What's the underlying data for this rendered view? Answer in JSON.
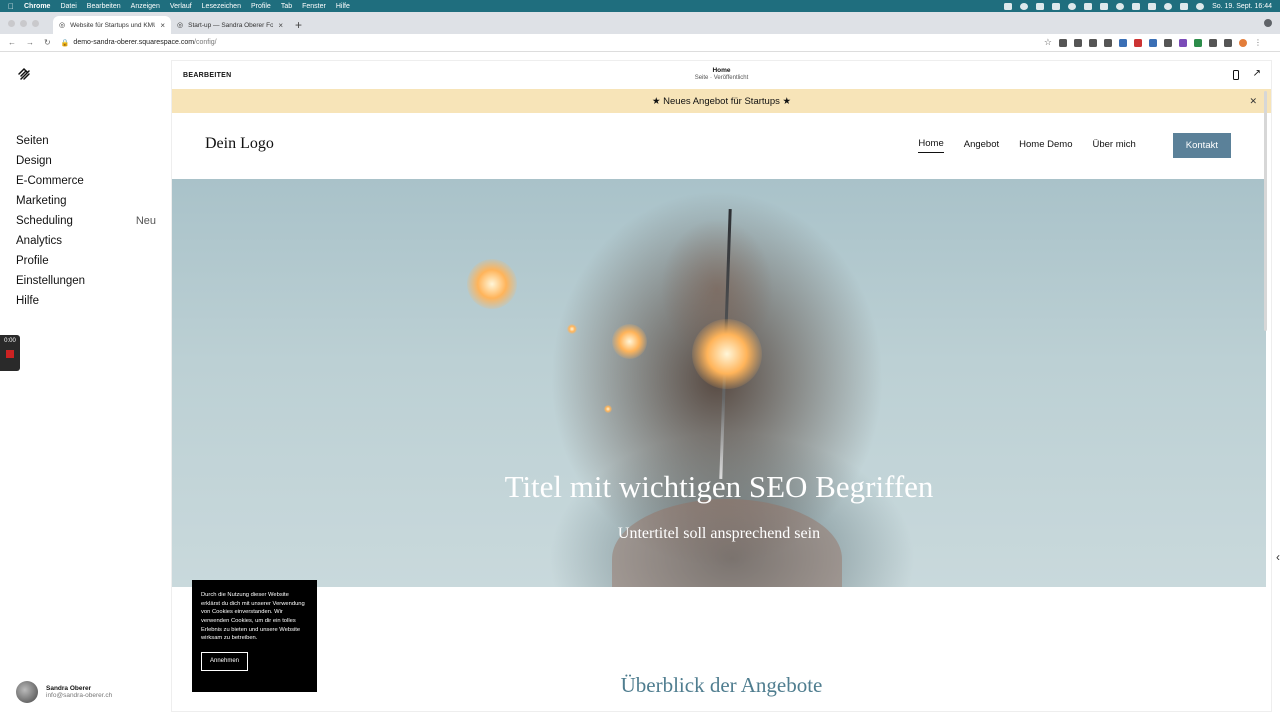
{
  "menubar": {
    "app": "Chrome",
    "items": [
      "Datei",
      "Bearbeiten",
      "Anzeigen",
      "Verlauf",
      "Lesezeichen",
      "Profile",
      "Tab",
      "Fenster",
      "Hilfe"
    ],
    "datetime": "So. 19. Sept. 16:44"
  },
  "tabs": [
    {
      "title": "Website für Startups und KMU",
      "icon": "squarespace-icon",
      "active": true
    },
    {
      "title": "Start-up — Sandra Oberer Fotografie",
      "icon": "squarespace-icon",
      "active": false
    }
  ],
  "address": {
    "host": "demo-sandra-oberer.squarespace.com",
    "path": "/config/"
  },
  "sidebar": {
    "items": [
      {
        "label": "Seiten",
        "badge": ""
      },
      {
        "label": "Design",
        "badge": ""
      },
      {
        "label": "E-Commerce",
        "badge": ""
      },
      {
        "label": "Marketing",
        "badge": ""
      },
      {
        "label": "Scheduling",
        "badge": "Neu"
      },
      {
        "label": "Analytics",
        "badge": ""
      },
      {
        "label": "Profile",
        "badge": ""
      },
      {
        "label": "Einstellungen",
        "badge": ""
      },
      {
        "label": "Hilfe",
        "badge": ""
      }
    ],
    "recorder_time": "0:00",
    "user": {
      "name": "Sandra Oberer",
      "email": "info@sandra-oberer.ch"
    }
  },
  "editor": {
    "edit_label": "BEARBEITEN",
    "page_title": "Home",
    "page_status": "Seite · Veröffentlicht"
  },
  "announcement": {
    "text": "★  Neues Angebot für Startups  ★"
  },
  "site": {
    "logo": "Dein Logo",
    "nav": [
      "Home",
      "Angebot",
      "Home Demo",
      "Über mich"
    ],
    "cta": "Kontakt"
  },
  "hero": {
    "title": "Titel mit wichtigen SEO Begriffen",
    "subtitle": "Untertitel soll ansprechend sein"
  },
  "cookie": {
    "text": "Durch die Nutzung dieser Website erklärst du dich mit unserer Verwendung von Cookies einverstanden. Wir verwenden Cookies, um dir ein tolles Erlebnis zu bieten und unsere Website wirksam zu betreiben.",
    "button": "Annehmen"
  },
  "section": {
    "title": "Überblick der Angebote"
  }
}
